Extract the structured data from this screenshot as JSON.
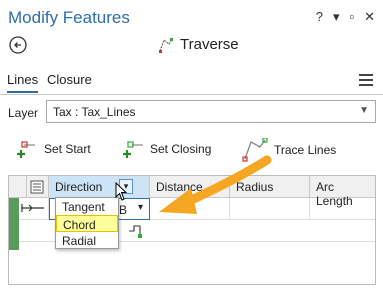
{
  "window": {
    "title": "Modify Features",
    "help": "?",
    "pin": "▾",
    "close": "✕",
    "dock": "▫"
  },
  "tool": {
    "name": "Traverse"
  },
  "tabs": [
    {
      "label": "Lines"
    },
    {
      "label": "Closure"
    }
  ],
  "layer": {
    "label": "Layer",
    "value": "Tax : Tax_Lines"
  },
  "toolbar": {
    "set_start": "Set Start",
    "set_closing": "Set Closing",
    "trace_lines": "Trace Lines"
  },
  "grid": {
    "columns": [
      "Direction",
      "Distance",
      "Radius",
      "Arc Length"
    ],
    "row1_value": "B",
    "dropdown_options": [
      "Tangent",
      "Chord",
      "Radial"
    ],
    "highlighted_option": "Chord"
  },
  "colors": {
    "accent": "#2d6ea8",
    "highlight": "#ffff99",
    "arrow": "#f5a623",
    "gutter": "#5a9a5a"
  }
}
